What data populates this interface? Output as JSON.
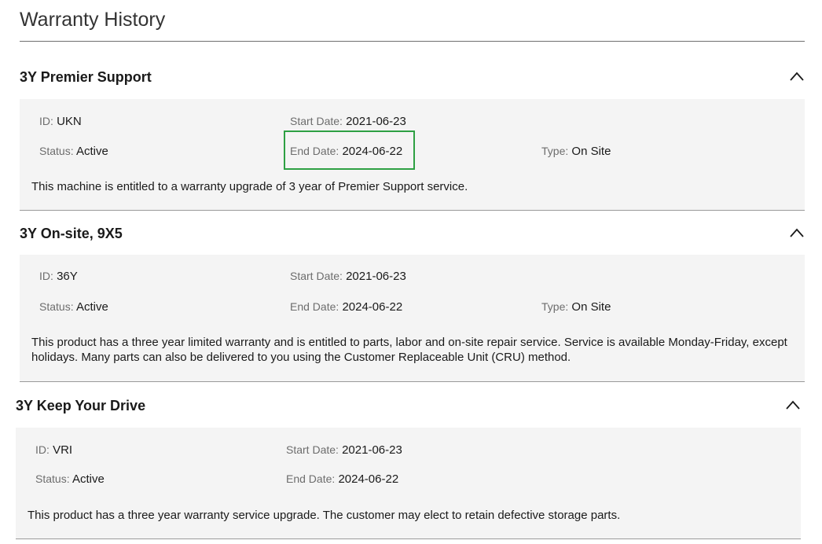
{
  "page": {
    "title": "Warranty History"
  },
  "icons": {
    "collapse": "chevron-up-icon"
  },
  "colors": {
    "highlight": "#2ea043"
  },
  "labels": {
    "id": "ID",
    "start_date": "Start Date",
    "end_date": "End Date",
    "status": "Status",
    "type": "Type",
    "sep": ":"
  },
  "sections": [
    {
      "title": "3Y Premier Support",
      "id": "UKN",
      "start_date": "2021-06-23",
      "status": "Active",
      "end_date": "2024-06-22",
      "type": "On Site",
      "description": "This machine is entitled to a warranty upgrade of 3 year of Premier Support service."
    },
    {
      "title": "3Y On-site, 9X5",
      "id": "36Y",
      "start_date": "2021-06-23",
      "status": "Active",
      "end_date": "2024-06-22",
      "type": "On Site",
      "description": "This product has a three year limited warranty and is entitled to parts, labor and on-site repair service. Service is available Monday-Friday, except holidays. Many parts can also be delivered to you using the Customer Replaceable Unit (CRU) method."
    },
    {
      "title": "3Y Keep Your Drive",
      "id": "VRI",
      "start_date": "2021-06-23",
      "status": "Active",
      "end_date": "2024-06-22",
      "description": "This product has a three year warranty service upgrade. The customer may elect to retain defective storage parts."
    }
  ]
}
